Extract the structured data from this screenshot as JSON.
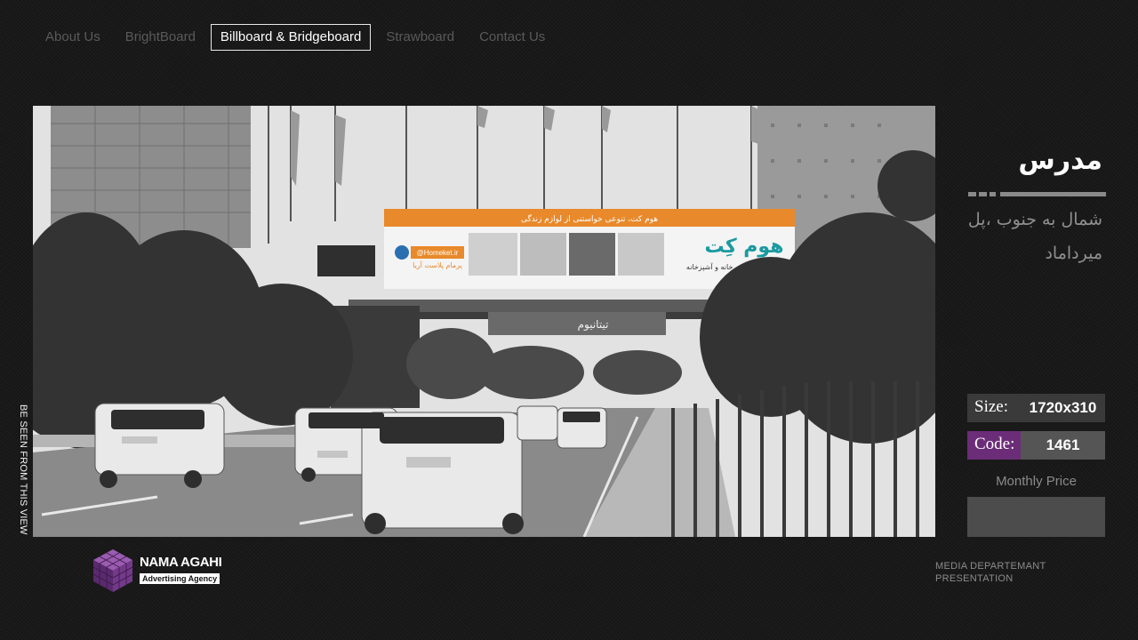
{
  "nav": {
    "items": [
      {
        "label": "About Us"
      },
      {
        "label": "BrightBoard"
      },
      {
        "label": "Billboard & Bridgeboard"
      },
      {
        "label": "Strawboard"
      },
      {
        "label": "Contact Us"
      }
    ],
    "active_index": 2
  },
  "photo": {
    "side_label": "BE SEEN FROM THIS VIEW",
    "billboard": {
      "top_banner": "هوم کت، تنوعی خواستنی از لوازم زندگی",
      "brand": "هوم کِت",
      "brand_tagline": "تولید کننده لوازم خانه و آشپزخانه",
      "website": "@Homeket.ir",
      "company": "پرمام پلاست آریا"
    },
    "lower_sign": "تیتانیوم"
  },
  "location": {
    "title": "مدرس",
    "subtitle": "شمال به جنوب ،پل میرداماد"
  },
  "specs": {
    "size_label": "Size:",
    "size_value": "1720x310",
    "code_label": "Code:",
    "code_value": "1461",
    "monthly_price_label": "Monthly Price",
    "monthly_price_value": ""
  },
  "footer": {
    "logo_name": "NAMA AGAHI",
    "logo_tagline": "Advertising Agency",
    "right_line1": "MEDIA DEPARTEMANT",
    "right_line2": "PRESENTATION"
  },
  "colors": {
    "accent_purple": "#6b2c78",
    "billboard_orange": "#e8892b",
    "background": "#161616"
  }
}
